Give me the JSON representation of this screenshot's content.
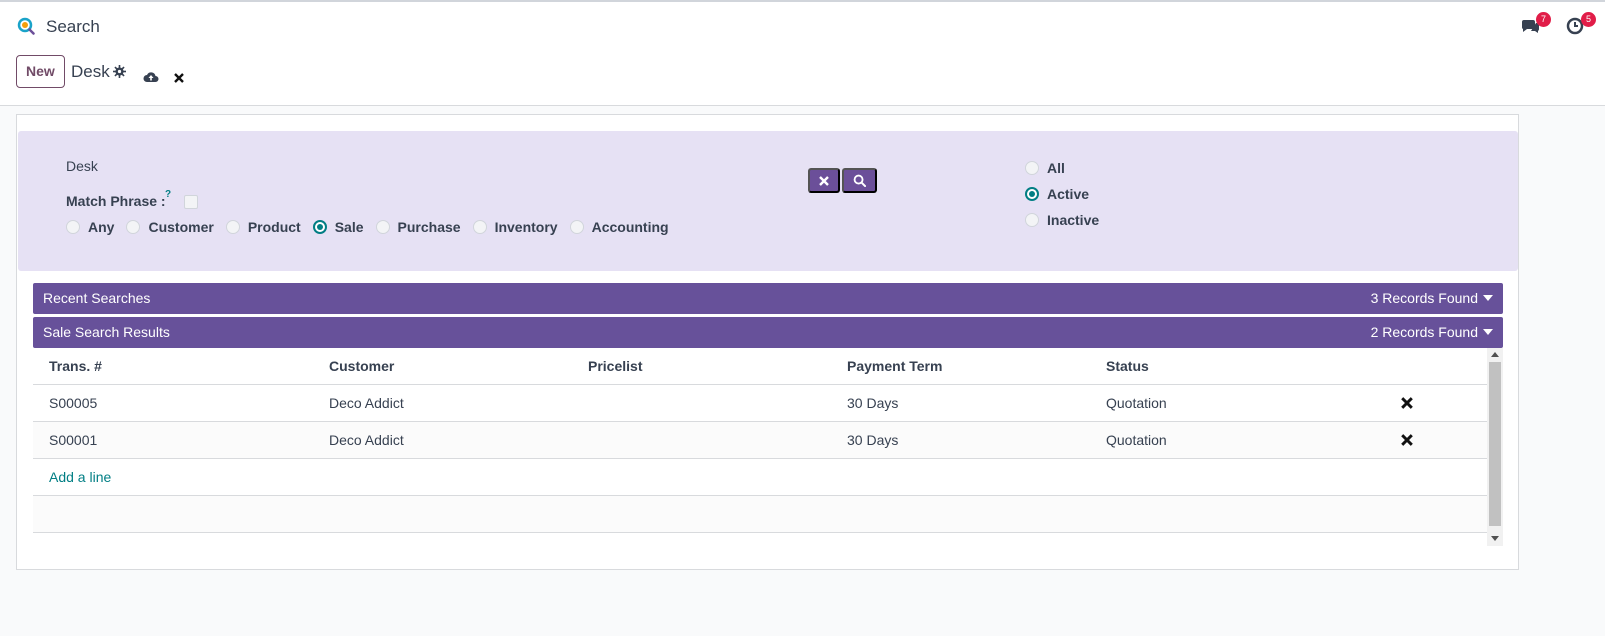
{
  "app": {
    "title": "Search",
    "logo_icon": "search-app-icon"
  },
  "systray": {
    "messages": {
      "icon": "chat-icon",
      "count": "7"
    },
    "activities": {
      "icon": "clock-icon",
      "count": "5"
    }
  },
  "control_panel": {
    "new_label": "New",
    "record_name": "Desk",
    "actions": [
      "gear-icon",
      "cloud-upload-icon",
      "close-icon"
    ]
  },
  "search": {
    "desk_label": "Desk",
    "match_phrase_label": "Match Phrase :",
    "help_marker": "?",
    "match_phrase_checked": false,
    "categories": [
      {
        "label": "Any",
        "checked": false
      },
      {
        "label": "Customer",
        "checked": false
      },
      {
        "label": "Product",
        "checked": false
      },
      {
        "label": "Sale",
        "checked": true
      },
      {
        "label": "Purchase",
        "checked": false
      },
      {
        "label": "Inventory",
        "checked": false
      },
      {
        "label": "Accounting",
        "checked": false
      }
    ],
    "status_options": [
      {
        "label": "All",
        "checked": false
      },
      {
        "label": "Active",
        "checked": true
      },
      {
        "label": "Inactive",
        "checked": false
      }
    ],
    "clear_icon": "close-icon",
    "search_icon": "search-icon"
  },
  "recent_searches": {
    "title": "Recent Searches",
    "count": "3 Records Found"
  },
  "sale_results": {
    "title": "Sale Search Results",
    "count": "2 Records Found",
    "columns": [
      "Trans. #",
      "Customer",
      "Pricelist",
      "Payment Term",
      "Status"
    ],
    "rows": [
      {
        "trans": "S00005",
        "customer": "Deco Addict",
        "pricelist": "",
        "payment_term": "30 Days",
        "status": "Quotation"
      },
      {
        "trans": "S00001",
        "customer": "Deco Addict",
        "pricelist": "",
        "payment_term": "30 Days",
        "status": "Quotation"
      }
    ],
    "add_line": "Add a line"
  },
  "colors": {
    "accent": "#67519a",
    "brand": "#714b67",
    "link": "#017e84",
    "badge": "#e11d48",
    "panel": "#e6e1f4"
  }
}
